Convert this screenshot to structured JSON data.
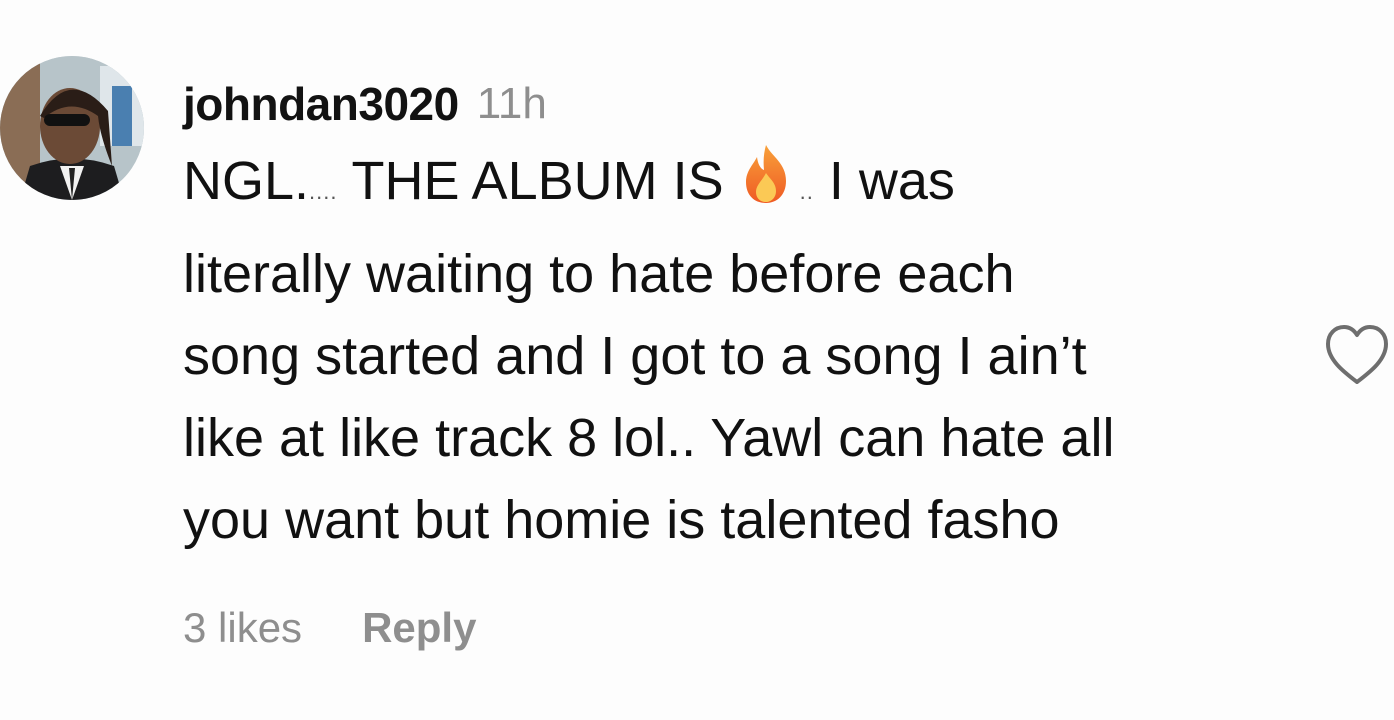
{
  "comment": {
    "username": "johndan3020",
    "time": "11h",
    "text_lines": [
      "literally waiting to hate before each",
      "song started and I got to a song I ain’t",
      "like at like track 8 lol.. Yawl can hate all",
      "you want but homie is talented fasho"
    ],
    "first_line": {
      "part1": "NGL.",
      "dots": "....",
      "part2": "THE ALBUM IS",
      "emoji": "fire-icon",
      "mid_dots": "..",
      "part3": "I was"
    },
    "likes_label": "3 likes",
    "reply_label": "Reply"
  },
  "icons": {
    "avatar": "avatar",
    "like": "heart-icon",
    "emoji": "fire-icon"
  },
  "colors": {
    "text": "#111111",
    "muted": "#8e8e8e",
    "background": "#fdfdfd"
  }
}
